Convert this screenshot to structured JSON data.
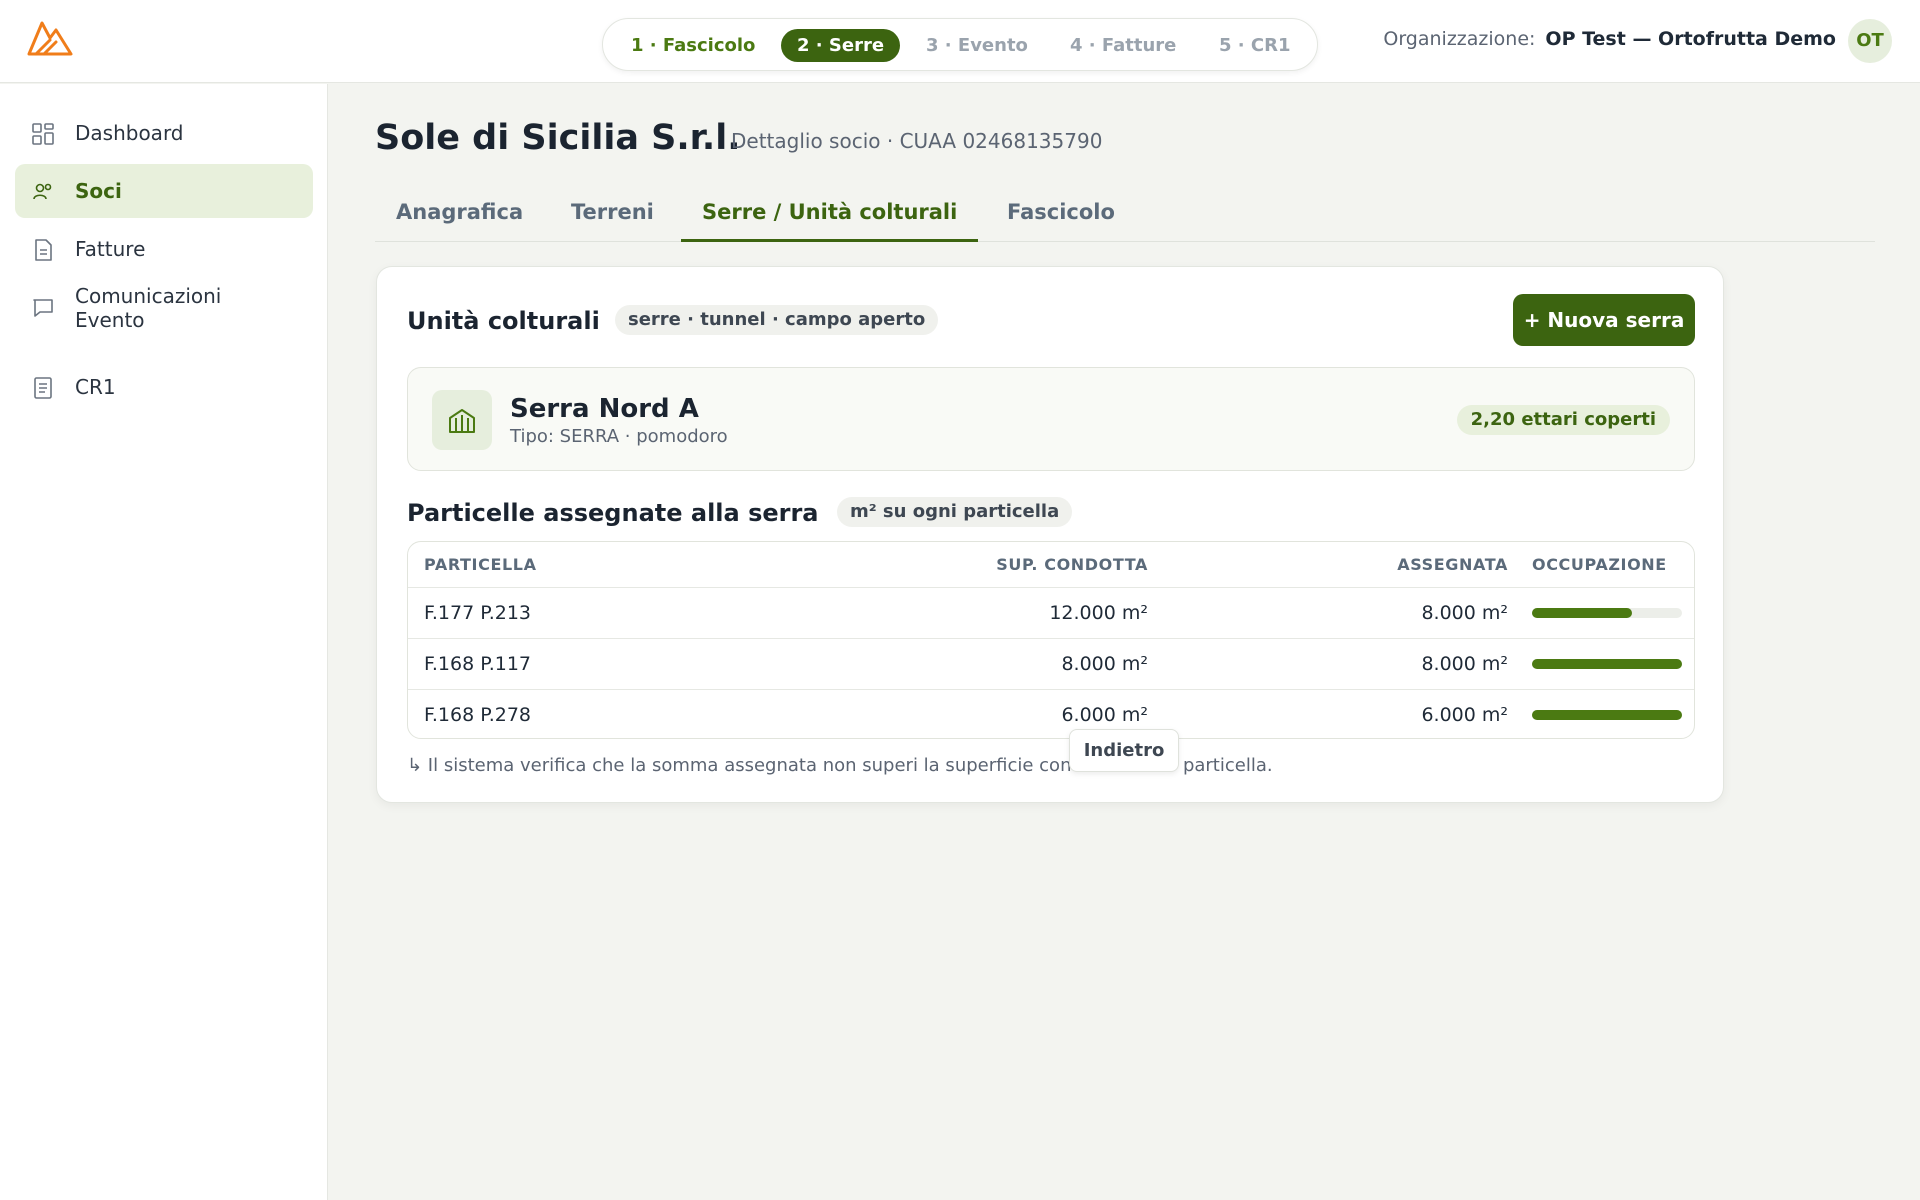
{
  "header": {
    "org_label": "Organizzazione:",
    "org_name": "OP Test — Ortofrutta Demo",
    "avatar_initials": "OT",
    "steps": [
      {
        "label": "1 · Fascicolo",
        "state": "done"
      },
      {
        "label": "2 · Serre",
        "state": "active"
      },
      {
        "label": "3 · Evento",
        "state": "pending"
      },
      {
        "label": "4 · Fatture",
        "state": "pending"
      },
      {
        "label": "5 · CR1",
        "state": "pending"
      }
    ]
  },
  "sidebar": {
    "items": [
      {
        "label": "Dashboard",
        "icon": "grid-icon",
        "active": false
      },
      {
        "label": "Soci",
        "icon": "users-icon",
        "active": true
      },
      {
        "label": "Fatture",
        "icon": "document-icon",
        "active": false
      },
      {
        "label": "Comunicazioni Evento",
        "icon": "message-icon",
        "active": false
      },
      {
        "label": "CR1",
        "icon": "list-document-icon",
        "active": false
      }
    ]
  },
  "page": {
    "title": "Sole di Sicilia S.r.l.",
    "subtitle": "Dettaglio socio · CUAA 02468135790"
  },
  "tabs": [
    {
      "label": "Anagrafica",
      "active": false
    },
    {
      "label": "Terreni",
      "active": false
    },
    {
      "label": "Serre / Unità colturali",
      "active": true
    },
    {
      "label": "Fascicolo",
      "active": false
    }
  ],
  "units": {
    "title": "Unità colturali",
    "chip": "serre · tunnel · campo aperto",
    "new_button": "+ Nuova serra",
    "serra": {
      "name": "Serra Nord A",
      "meta": "Tipo: SERRA · pomodoro",
      "badge": "2,20 ettari coperti",
      "icon": "greenhouse-icon"
    }
  },
  "parcels": {
    "title": "Particelle assegnate alla serra",
    "chip": "m² su ogni particella",
    "headers": [
      "PARTICELLA",
      "SUP. CONDOTTA",
      "ASSEGNATA",
      "OCCUPAZIONE"
    ],
    "rows": [
      {
        "particella": "F.177 P.213",
        "condotta": "12.000 m²",
        "assegnata": "8.000 m²",
        "occupazione": 0.667
      },
      {
        "particella": "F.168 P.117",
        "condotta": "8.000 m²",
        "assegnata": "8.000 m²",
        "occupazione": 1.0
      },
      {
        "particella": "F.168 P.278",
        "condotta": "6.000 m²",
        "assegnata": "6.000 m²",
        "occupazione": 1.0
      }
    ],
    "note_before": "↳ Il sistema verifica che la somma assegnata non superi la superficie con",
    "note_after": "particella."
  },
  "tooltip": "Indietro",
  "colors": {
    "accent": "#3c6410",
    "accent_light": "#e8f0dc",
    "logo": "#f07d1a"
  }
}
